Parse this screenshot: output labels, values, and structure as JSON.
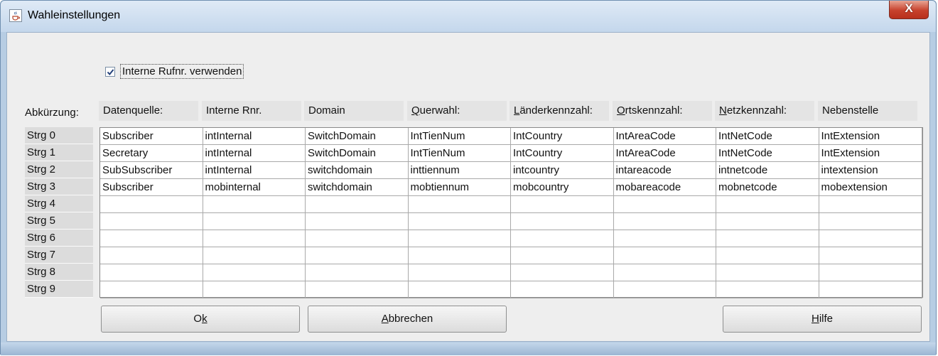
{
  "window": {
    "title": "Wahleinstellungen",
    "close_glyph": "X",
    "app_icon": "java-cup-icon"
  },
  "checkbox": {
    "label": "Interne Rufnr. verwenden",
    "checked": true
  },
  "row_header_title": "Abkürzung:",
  "columns": [
    {
      "pre": "",
      "key": "",
      "post": "Datenquelle:"
    },
    {
      "pre": "",
      "key": "",
      "post": "Interne Rnr."
    },
    {
      "pre": "",
      "key": "",
      "post": "Domain"
    },
    {
      "pre": "",
      "key": "Q",
      "post": "uerwahl:"
    },
    {
      "pre": "",
      "key": "L",
      "post": "änderkennzahl:"
    },
    {
      "pre": "",
      "key": "O",
      "post": "rtskennzahl:"
    },
    {
      "pre": "",
      "key": "N",
      "post": "etzkennzahl:"
    },
    {
      "pre": "",
      "key": "",
      "post": "Nebenstelle"
    }
  ],
  "rows": [
    {
      "label": "Strg 0",
      "cells": [
        "Subscriber",
        "intInternal",
        "SwitchDomain",
        "IntTienNum",
        "IntCountry",
        "IntAreaCode",
        "IntNetCode",
        "IntExtension"
      ]
    },
    {
      "label": "Strg 1",
      "cells": [
        "Secretary",
        "intInternal",
        "SwitchDomain",
        "IntTienNum",
        "IntCountry",
        "IntAreaCode",
        "IntNetCode",
        "IntExtension"
      ]
    },
    {
      "label": "Strg 2",
      "cells": [
        "SubSubscriber",
        "intInternal",
        "switchdomain",
        "inttiennum",
        "intcountry",
        "intareacode",
        "intnetcode",
        "intextension"
      ]
    },
    {
      "label": "Strg 3",
      "cells": [
        "Subscriber",
        "mobinternal",
        "switchdomain",
        "mobtiennum",
        "mobcountry",
        "mobareacode",
        "mobnetcode",
        "mobextension"
      ]
    },
    {
      "label": "Strg 4",
      "cells": [
        "",
        "",
        "",
        "",
        "",
        "",
        "",
        ""
      ]
    },
    {
      "label": "Strg 5",
      "cells": [
        "",
        "",
        "",
        "",
        "",
        "",
        "",
        ""
      ]
    },
    {
      "label": "Strg 6",
      "cells": [
        "",
        "",
        "",
        "",
        "",
        "",
        "",
        ""
      ]
    },
    {
      "label": "Strg 7",
      "cells": [
        "",
        "",
        "",
        "",
        "",
        "",
        "",
        ""
      ]
    },
    {
      "label": "Strg 8",
      "cells": [
        "",
        "",
        "",
        "",
        "",
        "",
        "",
        ""
      ]
    },
    {
      "label": "Strg 9",
      "cells": [
        "",
        "",
        "",
        "",
        "",
        "",
        "",
        ""
      ]
    }
  ],
  "buttons": {
    "ok": {
      "pre": "O",
      "key": "k",
      "post": ""
    },
    "cancel": {
      "pre": "",
      "key": "A",
      "post": "bbrechen"
    },
    "help": {
      "pre": "",
      "key": "H",
      "post": "ilfe"
    }
  }
}
